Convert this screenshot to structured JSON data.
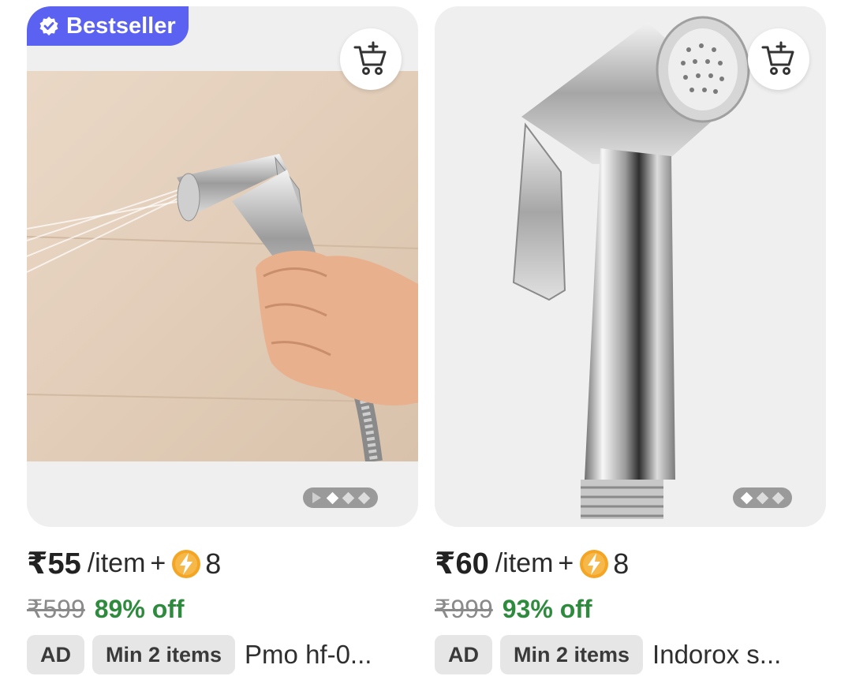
{
  "products": [
    {
      "badge": "Bestseller",
      "price": "₹55",
      "unit": "/item",
      "plus": "+",
      "coins": "8",
      "original_price": "₹599",
      "discount": "89% off",
      "ad_label": "AD",
      "min_label": "Min 2 items",
      "title": "Pmo hf-0..."
    },
    {
      "price": "₹60",
      "unit": "/item",
      "plus": "+",
      "coins": "8",
      "original_price": "₹999",
      "discount": "93% off",
      "ad_label": "AD",
      "min_label": "Min 2 items",
      "title": "Indorox s..."
    }
  ],
  "colors": {
    "badge": "#5b61f0",
    "discount": "#2e8b3e",
    "coin": "#f5a524"
  },
  "icons": [
    "verified-check-icon",
    "add-to-cart-icon",
    "lightning-coin-icon",
    "play-icon"
  ],
  "carousel": {
    "left_active_index": 1,
    "right_active_index": 0
  }
}
